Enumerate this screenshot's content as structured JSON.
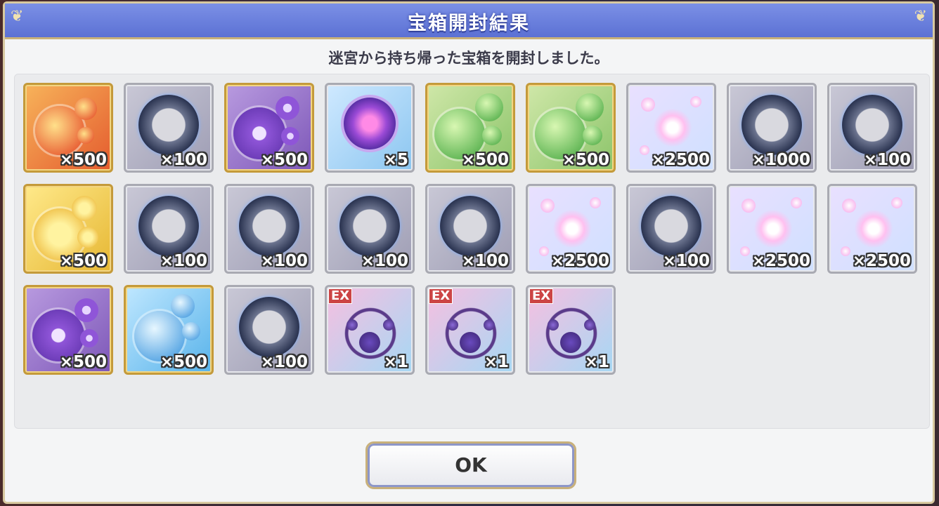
{
  "dialog": {
    "title": "宝箱開封結果",
    "subtitle": "迷宮から持ち帰った宝箱を開封しました。",
    "ok_label": "OK"
  },
  "items": [
    {
      "name": "fire-orbs",
      "icon": "fire-orb-icon",
      "theme": "t-orange",
      "frame": "gold",
      "qty": "×500"
    },
    {
      "name": "silver-medal",
      "icon": "memory-medal-icon",
      "theme": "t-gray",
      "frame": "silver",
      "qty": "×100"
    },
    {
      "name": "purple-orbs",
      "icon": "purple-orb-icon",
      "theme": "t-purple",
      "frame": "gold",
      "qty": "×500"
    },
    {
      "name": "crystal",
      "icon": "crystal-icon",
      "theme": "t-blue",
      "frame": "silver",
      "qty": "×5"
    },
    {
      "name": "green-orbs",
      "icon": "green-orb-icon",
      "theme": "t-green",
      "frame": "gold",
      "qty": "×500"
    },
    {
      "name": "green-orbs",
      "icon": "green-orb-icon",
      "theme": "t-green",
      "frame": "gold",
      "qty": "×500"
    },
    {
      "name": "star-shard",
      "icon": "star-shard-icon",
      "theme": "t-pink",
      "frame": "silver",
      "qty": "×2500"
    },
    {
      "name": "silver-medal",
      "icon": "memory-medal-icon",
      "theme": "t-gray",
      "frame": "silver",
      "qty": "×1000"
    },
    {
      "name": "silver-medal",
      "icon": "memory-medal-icon",
      "theme": "t-gray",
      "frame": "silver",
      "qty": "×100"
    },
    {
      "name": "sun-orbs",
      "icon": "sun-orb-icon",
      "theme": "t-yellow",
      "frame": "gold",
      "qty": "×500"
    },
    {
      "name": "silver-medal",
      "icon": "memory-medal-icon",
      "theme": "t-gray",
      "frame": "silver",
      "qty": "×100"
    },
    {
      "name": "silver-medal",
      "icon": "memory-medal-icon",
      "theme": "t-gray",
      "frame": "silver",
      "qty": "×100"
    },
    {
      "name": "silver-medal",
      "icon": "memory-medal-icon",
      "theme": "t-gray",
      "frame": "silver",
      "qty": "×100"
    },
    {
      "name": "silver-medal",
      "icon": "memory-medal-icon",
      "theme": "t-gray",
      "frame": "silver",
      "qty": "×100"
    },
    {
      "name": "star-shard",
      "icon": "star-shard-icon",
      "theme": "t-pink",
      "frame": "silver",
      "qty": "×2500"
    },
    {
      "name": "silver-medal",
      "icon": "memory-medal-icon",
      "theme": "t-gray",
      "frame": "silver",
      "qty": "×100"
    },
    {
      "name": "star-shard",
      "icon": "star-shard-icon",
      "theme": "t-pink",
      "frame": "silver",
      "qty": "×2500"
    },
    {
      "name": "star-shard",
      "icon": "star-shard-icon",
      "theme": "t-pink",
      "frame": "silver",
      "qty": "×2500"
    },
    {
      "name": "purple-orbs",
      "icon": "purple-orb-icon",
      "theme": "t-purple",
      "frame": "gold",
      "qty": "×500"
    },
    {
      "name": "water-orbs",
      "icon": "water-orb-icon",
      "theme": "t-water",
      "frame": "gold",
      "qty": "×500"
    },
    {
      "name": "silver-medal",
      "icon": "memory-medal-icon",
      "theme": "t-gray",
      "frame": "silver",
      "qty": "×100"
    },
    {
      "name": "ex-necklace",
      "icon": "ex-necklace-icon",
      "theme": "t-ex",
      "frame": "silver",
      "qty": "×1",
      "ex": "EX"
    },
    {
      "name": "ex-necklace",
      "icon": "ex-necklace-icon",
      "theme": "t-ex",
      "frame": "silver",
      "qty": "×1",
      "ex": "EX"
    },
    {
      "name": "ex-necklace",
      "icon": "ex-necklace-icon",
      "theme": "t-ex",
      "frame": "silver",
      "qty": "×1",
      "ex": "EX"
    }
  ],
  "colors": {
    "title_bar": "#6a80dd",
    "frame_gold": "#c49a3a",
    "frame_silver": "#a9aab2"
  }
}
